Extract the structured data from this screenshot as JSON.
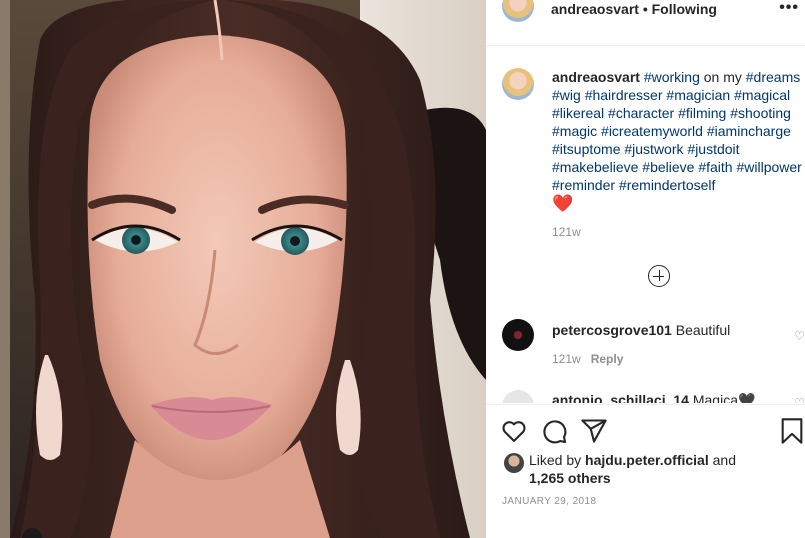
{
  "post": {
    "username": "andreaosvart",
    "separator": "•",
    "follow_status": "Following",
    "more_icon": "•••"
  },
  "caption": {
    "username": "andreaosvart",
    "parts": [
      {
        "text": "#working",
        "tag": true
      },
      {
        "text": " on my ",
        "tag": false
      },
      {
        "text": "#dreams",
        "tag": true
      },
      {
        "text": " ",
        "tag": false
      },
      {
        "text": "#wig",
        "tag": true
      },
      {
        "text": " ",
        "tag": false
      },
      {
        "text": "#hairdresser",
        "tag": true
      },
      {
        "text": " ",
        "tag": false
      },
      {
        "text": "#magician",
        "tag": true
      },
      {
        "text": " ",
        "tag": false
      },
      {
        "text": "#magical",
        "tag": true
      },
      {
        "text": " ",
        "tag": false
      },
      {
        "text": "#likereal",
        "tag": true
      },
      {
        "text": " ",
        "tag": false
      },
      {
        "text": "#character",
        "tag": true
      },
      {
        "text": " ",
        "tag": false
      },
      {
        "text": "#filming",
        "tag": true
      },
      {
        "text": " ",
        "tag": false
      },
      {
        "text": "#shooting",
        "tag": true
      },
      {
        "text": " ",
        "tag": false
      },
      {
        "text": "#magic",
        "tag": true
      },
      {
        "text": " ",
        "tag": false
      },
      {
        "text": "#icreatemyworld",
        "tag": true
      },
      {
        "text": " ",
        "tag": false
      },
      {
        "text": "#iamincharge",
        "tag": true
      },
      {
        "text": " ",
        "tag": false
      },
      {
        "text": "#itsuptome",
        "tag": true
      },
      {
        "text": " ",
        "tag": false
      },
      {
        "text": "#justwork",
        "tag": true
      },
      {
        "text": " ",
        "tag": false
      },
      {
        "text": "#justdoit",
        "tag": true
      },
      {
        "text": " ",
        "tag": false
      },
      {
        "text": "#makebelieve",
        "tag": true
      },
      {
        "text": " ",
        "tag": false
      },
      {
        "text": "#believe",
        "tag": true
      },
      {
        "text": " ",
        "tag": false
      },
      {
        "text": "#faith",
        "tag": true
      },
      {
        "text": " ",
        "tag": false
      },
      {
        "text": "#willpower",
        "tag": true
      },
      {
        "text": " ",
        "tag": false
      },
      {
        "text": "#reminder",
        "tag": true
      },
      {
        "text": " ",
        "tag": false
      },
      {
        "text": "#remindertoself",
        "tag": true
      }
    ],
    "emoji": "❤️",
    "age": "121w"
  },
  "comments": [
    {
      "username": "petercosgrove101",
      "text": "Beautiful",
      "age": "121w",
      "reply_label": "Reply",
      "like_icon": "♡"
    },
    {
      "username": "antonio_schillaci_14",
      "text": "Magica🖤",
      "like_icon": "♡"
    }
  ],
  "likes": {
    "prefix": "Liked by ",
    "user": "hajdu.peter.official",
    "middle": " and",
    "others": "1,265 others"
  },
  "date": "JANUARY 29, 2018",
  "colors": {
    "hashtag": "#00376b",
    "text": "#262626",
    "muted": "#8e8e8e",
    "heart": "#e0245e"
  },
  "icons": [
    "like-icon",
    "comment-icon",
    "share-icon",
    "bookmark-icon",
    "load-more-icon",
    "more-options-icon"
  ]
}
